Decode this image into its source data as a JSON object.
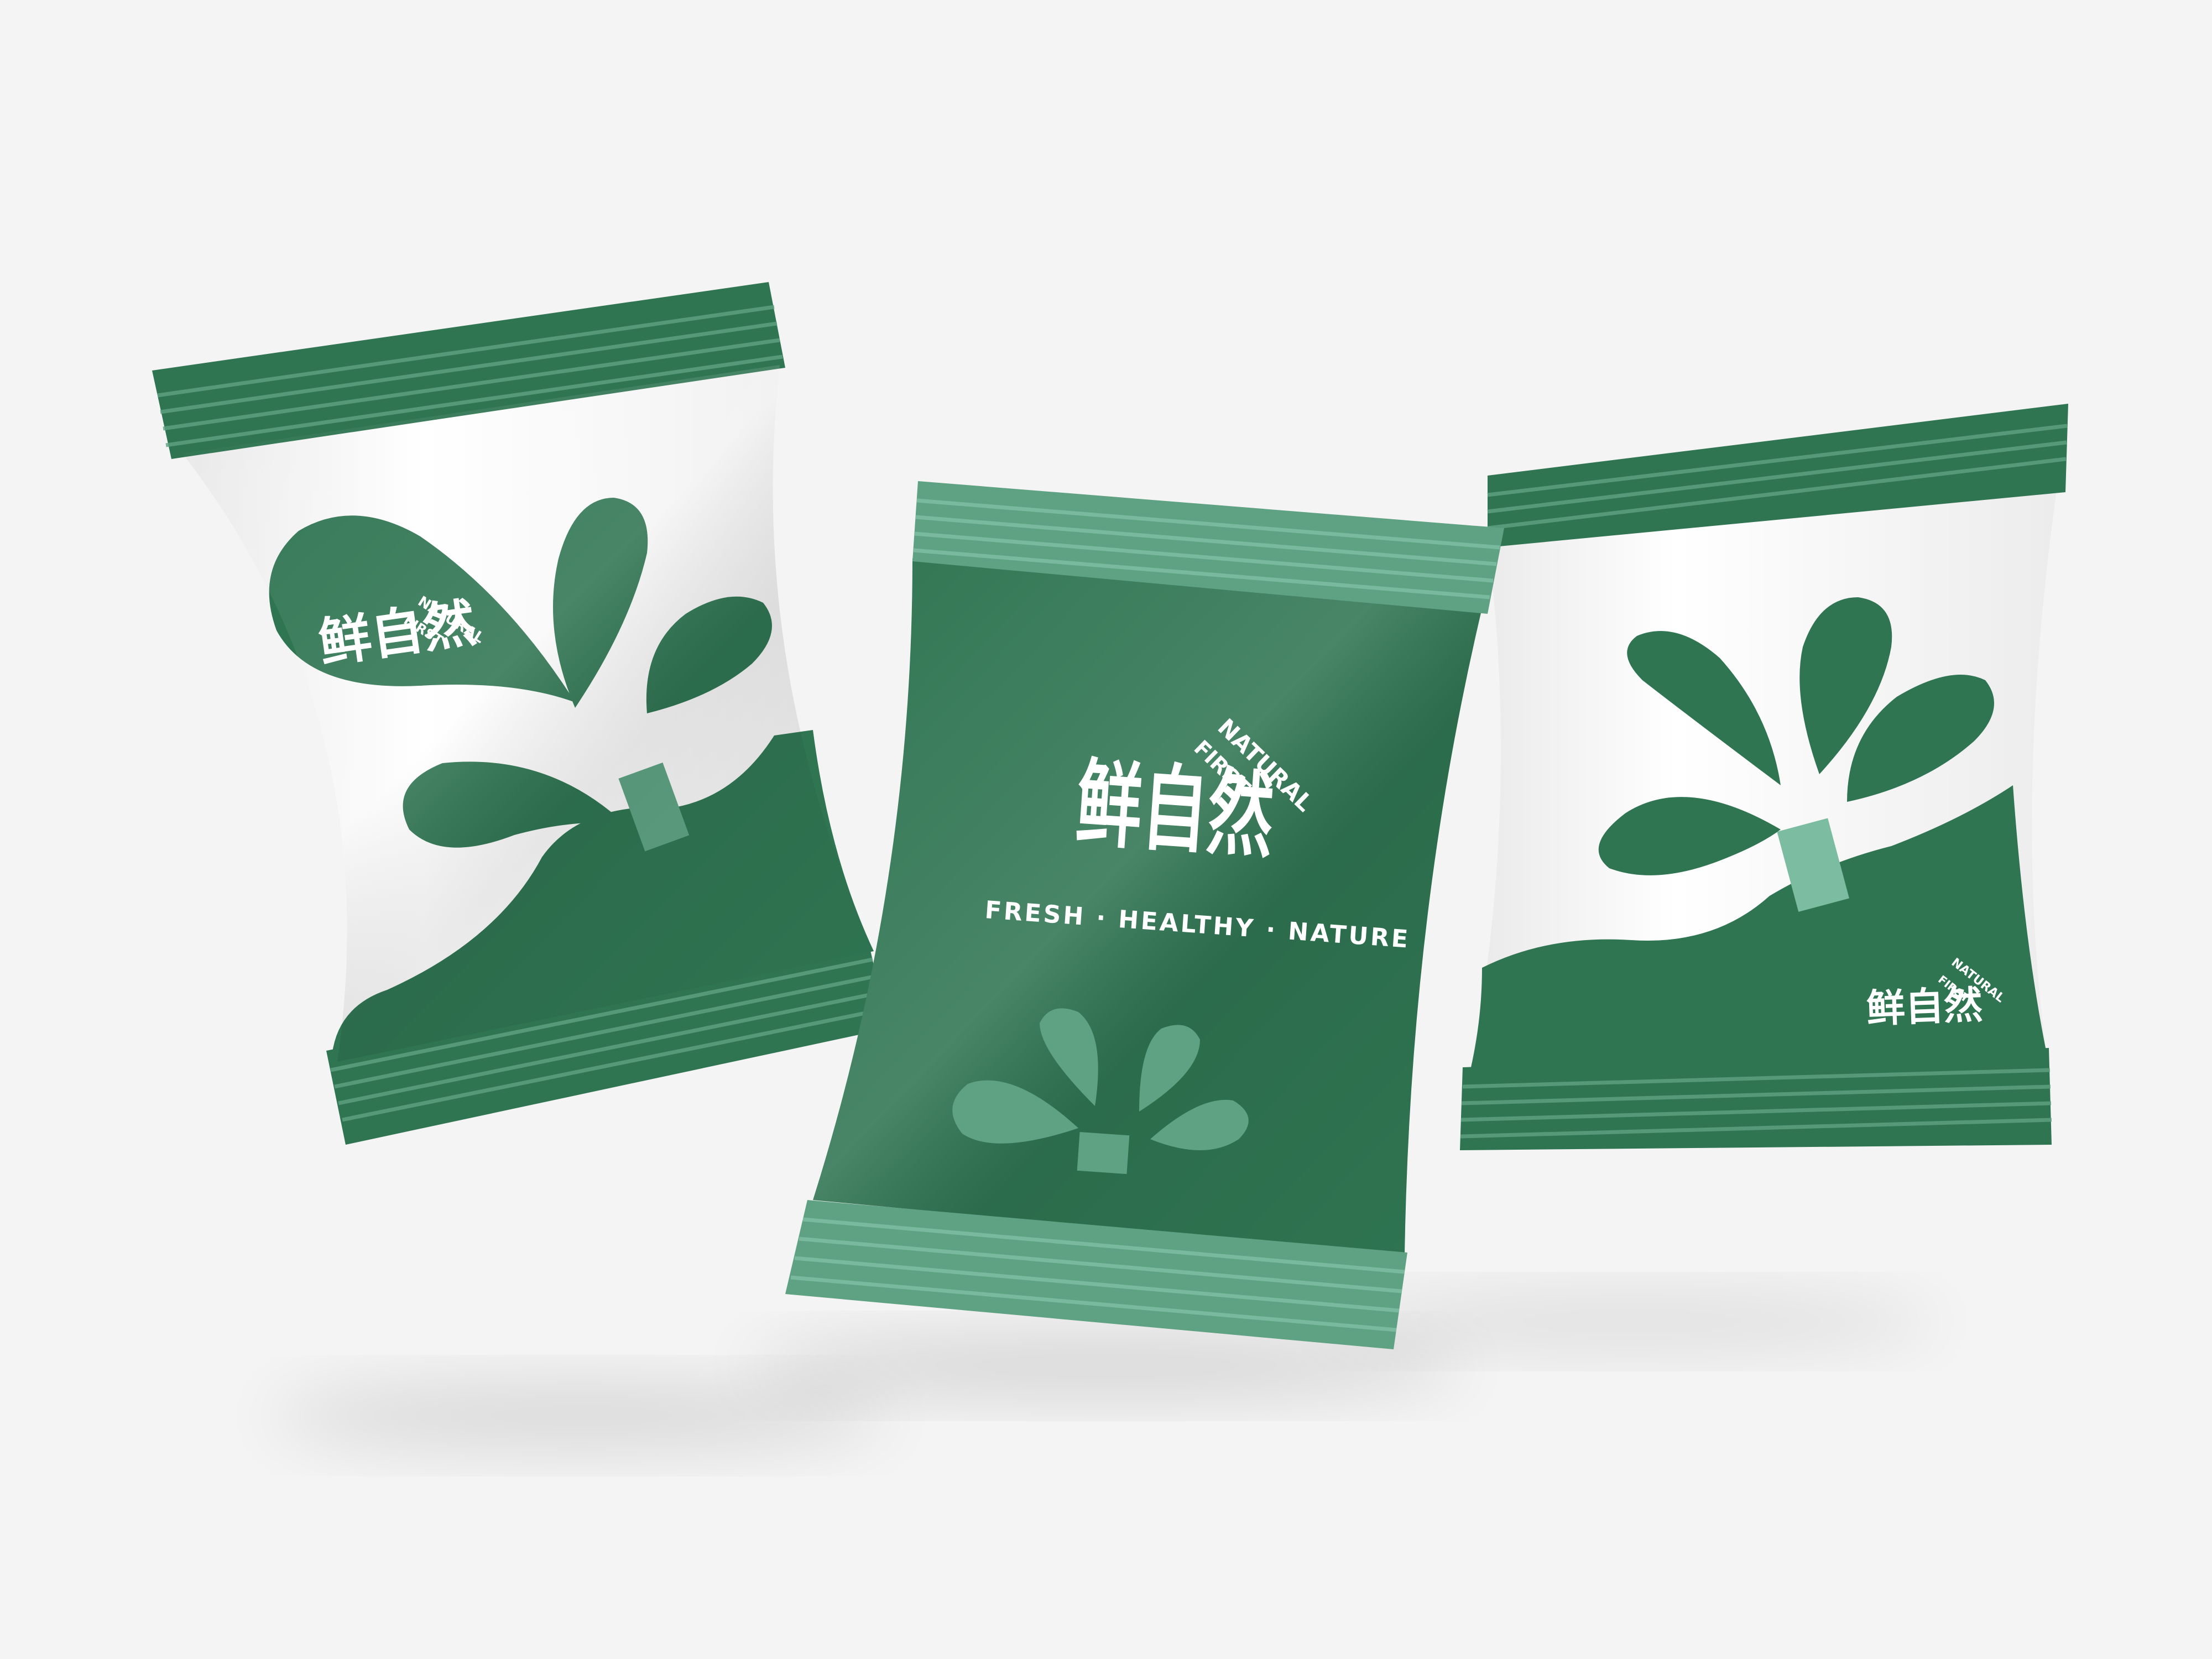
{
  "colors": {
    "background": "#f4f4f4",
    "dark_green": "#2f7552",
    "deep_green": "#2a6b49",
    "light_green": "#5fa283",
    "pale_green": "#7cbca0",
    "white": "#ffffff"
  },
  "brand": {
    "chinese_name": "鲜自然",
    "arc_line_1": "NATURAL",
    "arc_line_2": "FIRST",
    "tagline": "FRESH · HEALTHY · NATURE"
  },
  "packages": [
    {
      "name": "left-bag",
      "front": "white with green hills, tree and logo bubble"
    },
    {
      "name": "center-bag",
      "front": "green with logo and tagline"
    },
    {
      "name": "right-bag",
      "front": "white with green hills and tree, small logo bottom right"
    }
  ]
}
